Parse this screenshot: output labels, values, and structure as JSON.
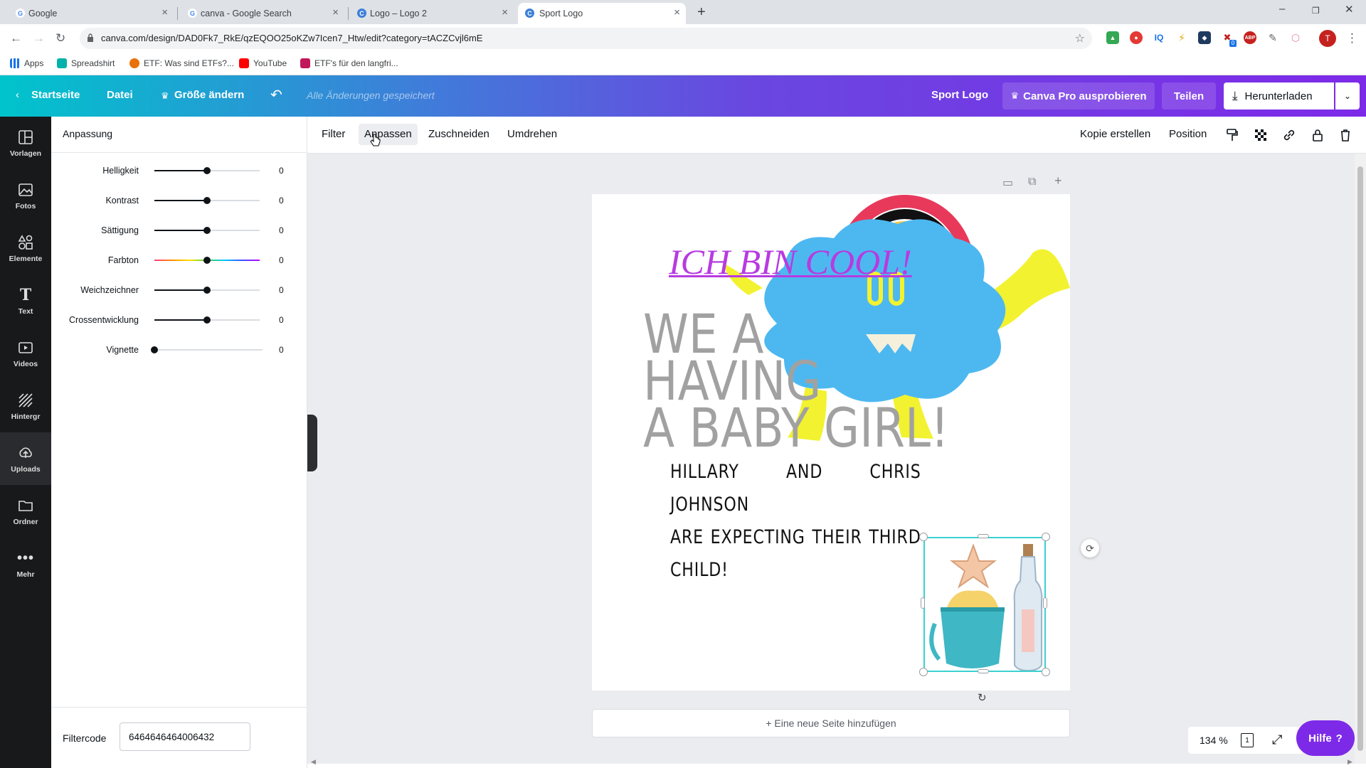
{
  "browser": {
    "tabs": [
      {
        "title": "Google",
        "favicon": "google-icon",
        "active": false
      },
      {
        "title": "canva - Google Search",
        "favicon": "google-icon",
        "active": false
      },
      {
        "title": "Logo – Logo 2",
        "favicon": "canva-icon",
        "active": false
      },
      {
        "title": "Sport Logo",
        "favicon": "canva-icon",
        "active": true
      }
    ],
    "new_tab": "+",
    "url": "canva.com/design/DAD0Fk7_RkE/qzEQOO25oKZw7Icen7_Htw/edit?category=tACZCvjl6mE",
    "profile_initial": "T",
    "ext_badge": "0",
    "bookmarks": [
      {
        "label": "Apps",
        "icon": "apps-grid-icon"
      },
      {
        "label": "Spreadshirt",
        "icon": "spreadshirt-icon"
      },
      {
        "label": "ETF: Was sind ETFs?...",
        "icon": "etf-icon"
      },
      {
        "label": "YouTube",
        "icon": "youtube-icon"
      },
      {
        "label": "ETF's für den langfri...",
        "icon": "etf-icon"
      }
    ]
  },
  "header": {
    "home": "Startseite",
    "file": "Datei",
    "resize": "Größe ändern",
    "saved_status": "Alle Änderungen gespeichert",
    "design_title": "Sport Logo",
    "pro": "Canva Pro ausprobieren",
    "share": "Teilen",
    "download": "Herunterladen",
    "colors": {
      "gradient_start": "#00c4cc",
      "gradient_end": "#7d2ae8"
    }
  },
  "rail": [
    {
      "label": "Vorlagen",
      "icon": "templates-icon"
    },
    {
      "label": "Fotos",
      "icon": "photos-icon"
    },
    {
      "label": "Elemente",
      "icon": "elements-icon"
    },
    {
      "label": "Text",
      "icon": "text-icon"
    },
    {
      "label": "Videos",
      "icon": "videos-icon"
    },
    {
      "label": "Hintergr",
      "icon": "background-icon"
    },
    {
      "label": "Uploads",
      "icon": "uploads-icon"
    },
    {
      "label": "Ordner",
      "icon": "folder-icon"
    },
    {
      "label": "Mehr",
      "icon": "more-icon"
    }
  ],
  "panel": {
    "title": "Anpassung",
    "sliders": [
      {
        "label": "Helligkeit",
        "value": "0",
        "level": 0.5
      },
      {
        "label": "Kontrast",
        "value": "0",
        "level": 0.5
      },
      {
        "label": "Sättigung",
        "value": "0",
        "level": 0.5
      },
      {
        "label": "Farbton",
        "value": "0",
        "level": 0.5
      },
      {
        "label": "Weichzeichner",
        "value": "0",
        "level": 0.5
      },
      {
        "label": "Crossentwicklung",
        "value": "0",
        "level": 0.5
      },
      {
        "label": "Vignette",
        "value": "0",
        "level": 0.0
      }
    ],
    "filtercode_label": "Filtercode",
    "filtercode_value": "6464646464006432"
  },
  "toolbar": {
    "filter": "Filter",
    "adjust": "Anpassen",
    "crop": "Zuschneiden",
    "flip": "Umdrehen",
    "duplicate": "Kopie erstellen",
    "position": "Position"
  },
  "canvas": {
    "headline": "ICH BIN COOL!",
    "baby_lines": [
      "WE A",
      "HAVING",
      "A BABY GIRL!"
    ],
    "announcement_lines": [
      "HILLARY AND CHRIS JOHNSON",
      "ARE EXPECTING THEIR THIRD",
      "CHILD!"
    ],
    "add_page": "+ Eine neue Seite hinzufügen",
    "colors": {
      "headline": "#b73be0",
      "cloud": "#4db8f0",
      "monster_limbs": "#f2f230",
      "selection": "#3bd1d1"
    }
  },
  "footer": {
    "zoom": "134 %",
    "page_number": "1",
    "help": "Hilfe",
    "help_mark": "?"
  }
}
